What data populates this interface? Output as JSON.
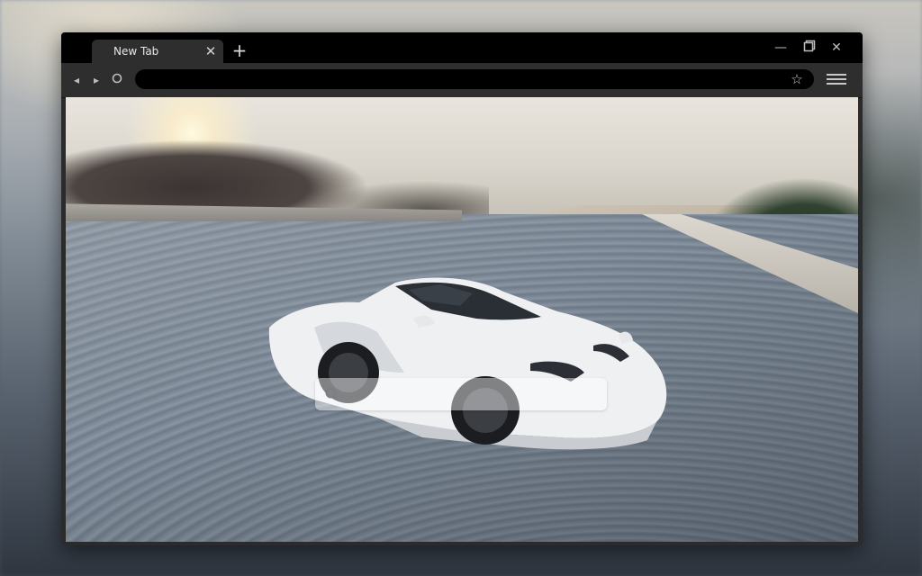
{
  "tab": {
    "title": "New Tab",
    "close_icon": "close-icon"
  },
  "new_tab_icon": "plus-icon",
  "window_controls": {
    "minimize_icon": "minimize-icon",
    "maximize_icon": "maximize-icon",
    "close_icon": "close-icon"
  },
  "toolbar": {
    "back_icon": "arrow-left-icon",
    "forward_icon": "arrow-right-icon",
    "reload_icon": "reload-icon",
    "address_value": "",
    "bookmark_icon": "star-icon",
    "menu_icon": "hamburger-menu-icon"
  },
  "page": {
    "background": "white sports convertible car on a race track",
    "search": {
      "placeholder": "",
      "value": ""
    }
  }
}
